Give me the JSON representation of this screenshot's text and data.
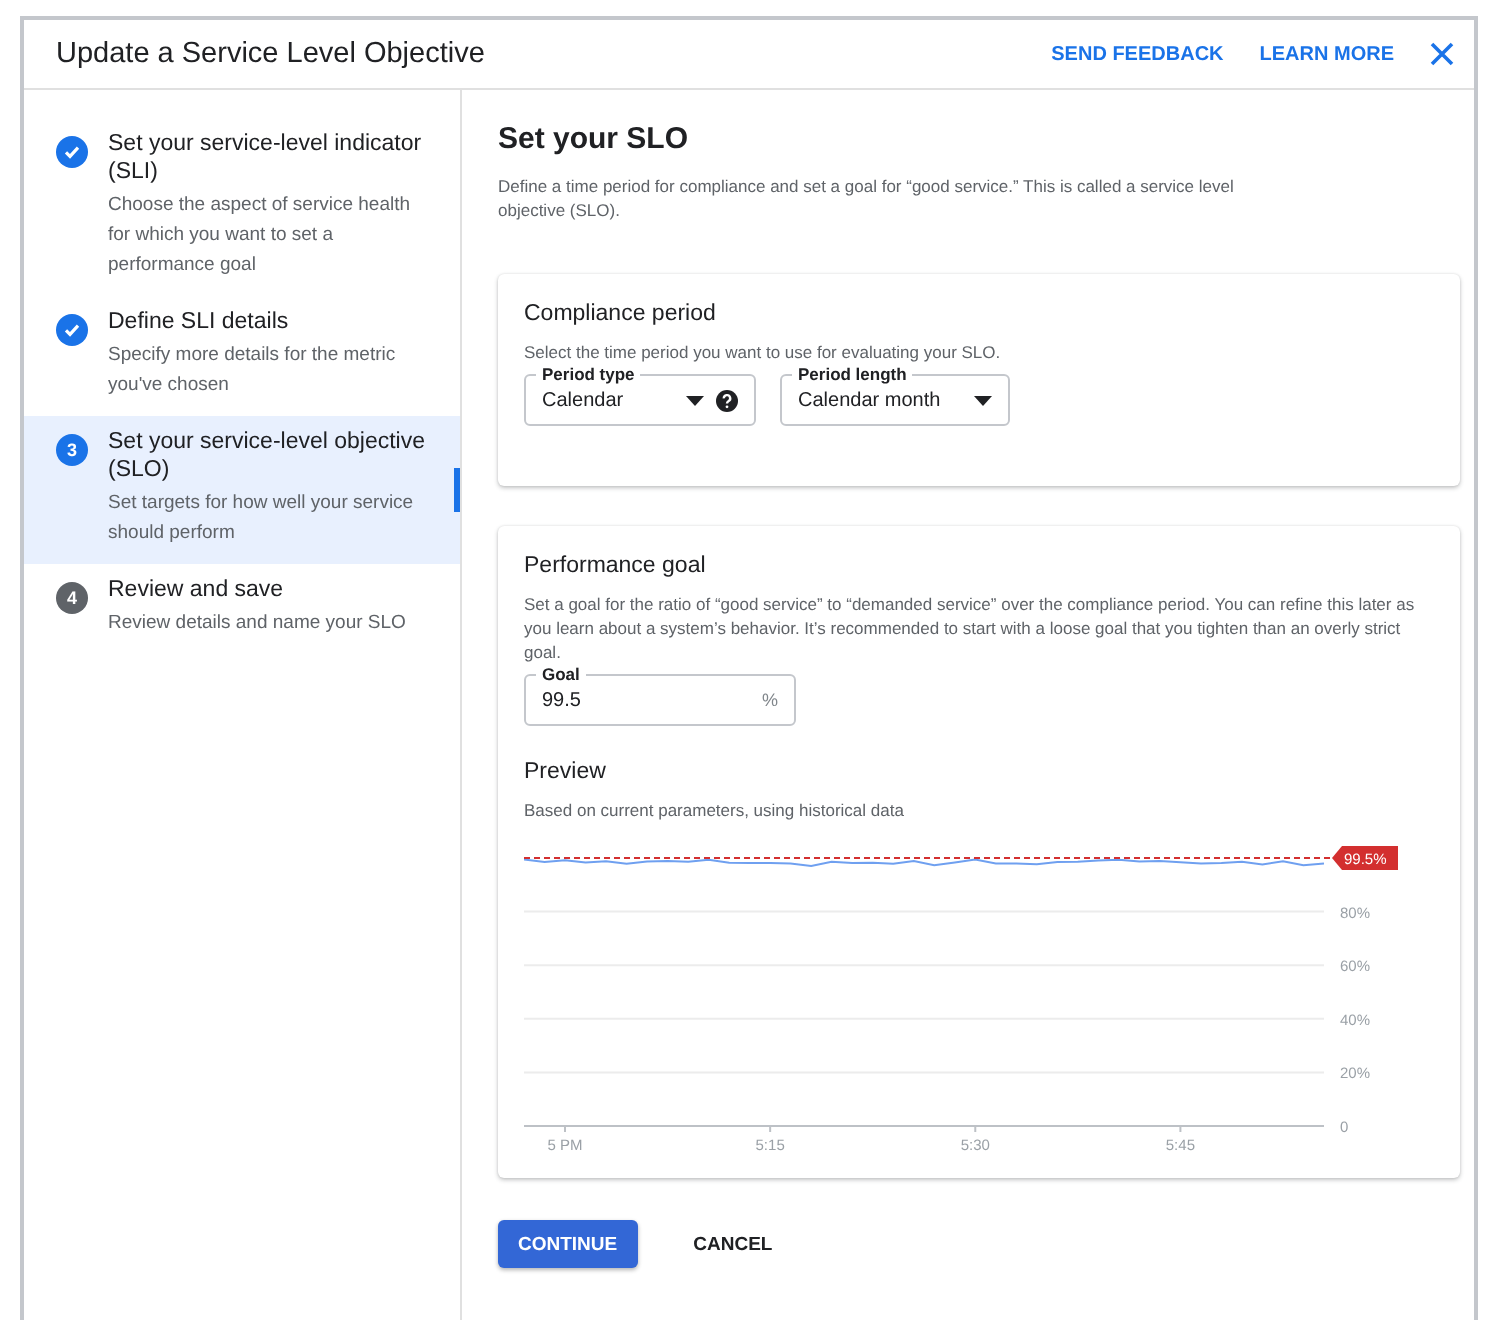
{
  "dialog": {
    "title": "Update a Service Level Objective",
    "actions": [
      "SEND FEEDBACK",
      "LEARN MORE"
    ]
  },
  "steps": [
    {
      "done": true,
      "title": "Set your service-level indicator (SLI)",
      "description": "Choose the aspect of service health for which you want to set a performance goal",
      "selected": false
    },
    {
      "done": true,
      "title": "Define SLI details",
      "description": "Specify more details for the metric you've chosen",
      "selected": false
    },
    {
      "done": false,
      "number": "3",
      "title": "Set your service-level objective (SLO)",
      "description": "Set targets for how well your service should perform",
      "selected": true
    },
    {
      "done": false,
      "number": "4",
      "title": "Review and save",
      "description": "Review details and name your SLO",
      "selected": false
    }
  ],
  "main": {
    "title": "Set your SLO",
    "description": "Define a time period for compliance and set a goal for “good service.” This is called a service level objective (SLO)."
  },
  "compliance": {
    "title": "Compliance period",
    "description": "Select the time period you want to use for evaluating your SLO.",
    "fields": [
      {
        "label": "Period type",
        "value": "Calendar",
        "help": true
      },
      {
        "label": "Period length",
        "value": "Calendar month",
        "help": false
      }
    ]
  },
  "performance": {
    "title": "Performance goal",
    "description": "Set a goal for the ratio of “good service” to “demanded service” over the compliance period. You can refine this later as you learn about a system’s behavior. It’s recommended to start with a loose goal that you tighten than an overly strict goal.",
    "goal": {
      "label": "Goal",
      "value": "99.5",
      "unit": "%"
    },
    "preview_title": "Preview",
    "preview_description": "Based on current parameters, using historical data",
    "chart_data": {
      "type": "line",
      "categories": [
        null,
        null,
        "5 PM",
        null,
        null,
        null,
        null,
        null,
        null,
        null,
        null,
        null,
        "5:15",
        null,
        null,
        null,
        null,
        null,
        null,
        null,
        null,
        null,
        "5:30",
        null,
        null,
        null,
        null,
        null,
        null,
        null,
        null,
        null,
        "5:45",
        null,
        null,
        null,
        null,
        null,
        null,
        null
      ],
      "series": [
        {
          "color": "#6fa0f0",
          "values": [
            99.5,
            98.5,
            99.2,
            98.3,
            98.8,
            97.8,
            98.7,
            98.9,
            98.6,
            99.3,
            98.2,
            98.1,
            98.1,
            98.0,
            97.0,
            98.6,
            98.1,
            98.2,
            97.8,
            98.9,
            97.3,
            98.3,
            99.4,
            97.9,
            98.0,
            97.7,
            98.5,
            98.6,
            99.1,
            99.3,
            98.7,
            98.9,
            98.4,
            97.9,
            98.1,
            98.6,
            97.5,
            98.8,
            97.3,
            98.0
          ]
        }
      ],
      "yticks": [
        {
          "value": 0,
          "label": "0"
        },
        {
          "value": 20,
          "label": "20%"
        },
        {
          "value": 40,
          "label": "40%"
        },
        {
          "value": 60,
          "label": "60%"
        },
        {
          "value": 80,
          "label": "80%"
        }
      ],
      "ylim": [
        0,
        100
      ],
      "grid": true
    },
    "goal_line": {
      "label": "99.5%"
    }
  },
  "buttons": [
    {
      "label": "CONTINUE",
      "kind": "primary"
    },
    {
      "label": "CANCEL",
      "kind": "text"
    }
  ]
}
